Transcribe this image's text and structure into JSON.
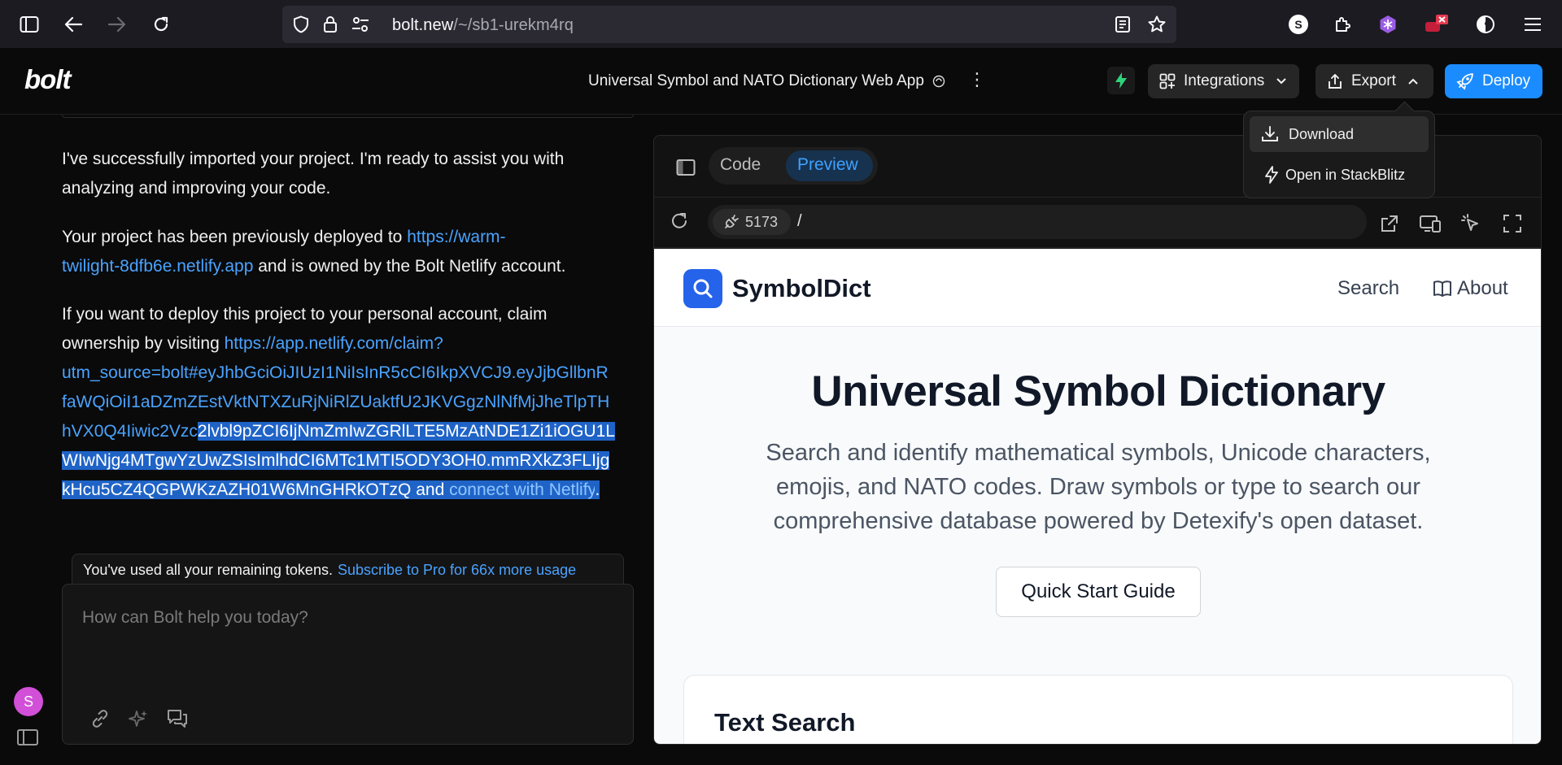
{
  "browser": {
    "url_host": "bolt.new",
    "url_path": "/~/sb1-urekm4rq",
    "profile_initial": "S"
  },
  "header": {
    "logo": "bolt",
    "project_title": "Universal Symbol and NATO Dictionary Web App",
    "integrations_label": "Integrations",
    "export_label": "Export",
    "deploy_label": "Deploy"
  },
  "export_menu": {
    "download_label": "Download",
    "stackblitz_label": "Open in StackBlitz"
  },
  "chat": {
    "msg1": "I've successfully imported your project. I'm ready to assist you with analyzing and improving your code.",
    "msg2_pre": "Your project has been previously deployed to ",
    "msg2_link_a": "https://warm-",
    "msg2_link_b": "twilight-8dfb6e.netlify.app",
    "msg2_post": " and is owned by the Bolt Netlify account.",
    "msg3_line1": "If you want to deploy this project to your personal account, claim",
    "msg3_line2_pre": "ownership by visiting ",
    "msg3_link_1": "https://app.netlify.com/claim?",
    "msg3_link_2": "utm_source=bolt#eyJhbGciOiJIUzI1NiIsInR5cCI6IkpXVCJ9.eyJjbGllbnR",
    "msg3_link_3": "faWQiOiI1aDZmZEstVktNTXZuRjNiRlZUaktfU2JKVGgzNlNfMjJheTlpTH",
    "msg3_link_4a": "hVX0Q4Iiwic2Vzc",
    "msg3_link_4b": "2lvbl9pZCI6IjNmZmIwZGRlLTE5MzAtNDE1Zi1iOGU1L",
    "msg3_link_5": "WIwNjg4MTgwYzUwZSIsImlhdCI6MTc1MTI5ODY3OH0.mmRXkZ3FLIjg",
    "msg3_link_6": "kHcu5CZ4QGPWKzAZH01W6MnGHRkOTzQ",
    "msg3_and": " and ",
    "msg3_connect": "connect with Netlify",
    "msg3_period": ".",
    "token_notice": "You've used all your remaining tokens.",
    "token_link": "Subscribe to Pro for 66x more usage",
    "input_placeholder": "How can Bolt help you today?",
    "user_initial": "S"
  },
  "workbench": {
    "tab_code": "Code",
    "tab_preview": "Preview",
    "port": "5173",
    "path": "/"
  },
  "site": {
    "brand": "SymbolDict",
    "nav_search": "Search",
    "nav_about": "About",
    "hero_title": "Universal Symbol Dictionary",
    "hero_line1": "Search and identify mathematical symbols, Unicode characters,",
    "hero_line2": "emojis, and NATO codes. Draw symbols or type to search our",
    "hero_line3": "comprehensive database powered by Detexify's open dataset.",
    "quick_start": "Quick Start Guide",
    "card_title": "Text Search"
  },
  "colors": {
    "accent": "#1a8cff",
    "link": "#4aa3ff",
    "selection": "#1f63c7",
    "site_primary": "#2563eb"
  }
}
